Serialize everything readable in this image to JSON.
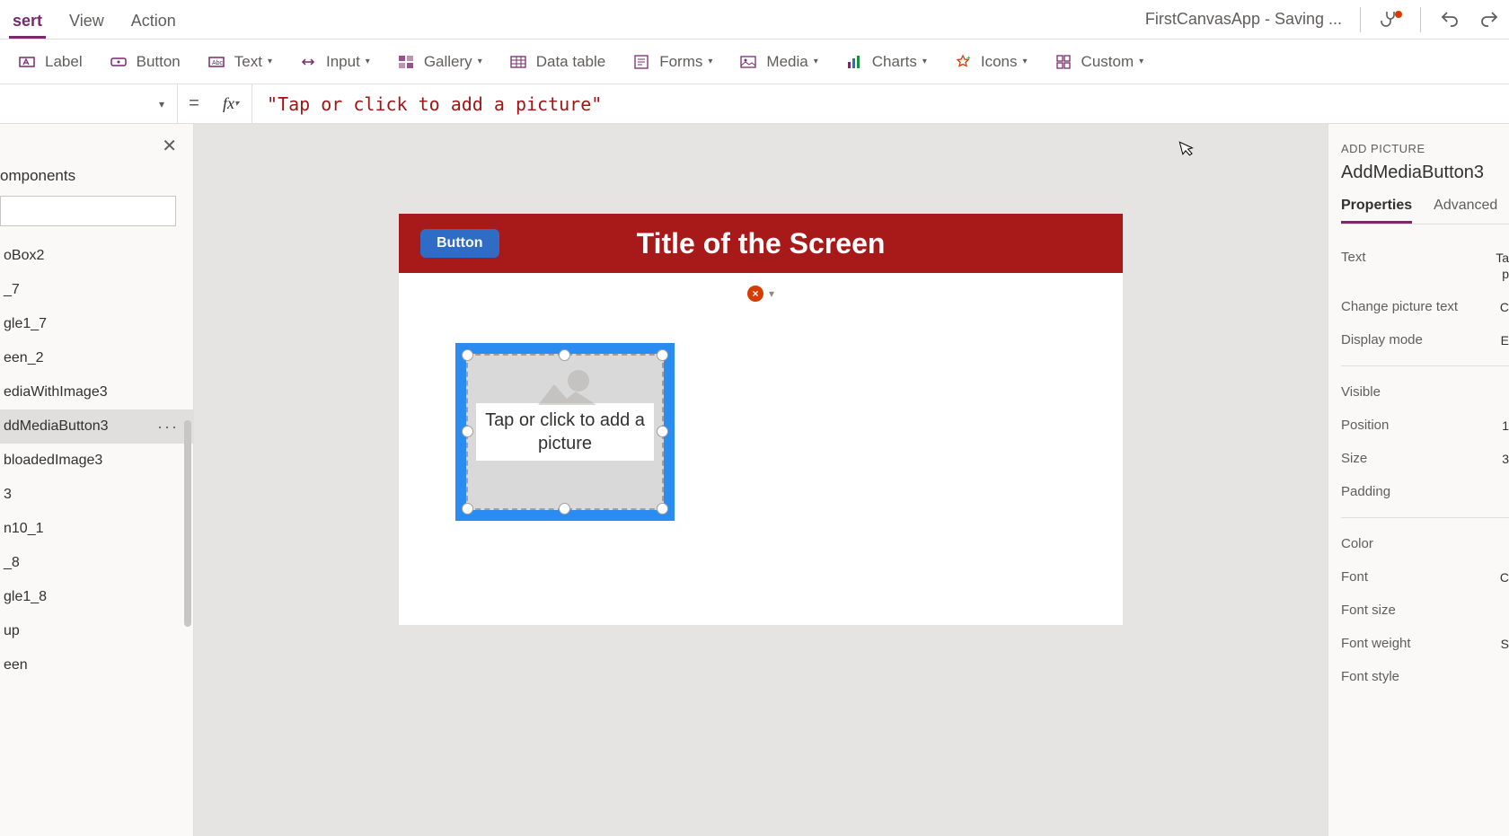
{
  "app_title": "FirstCanvasApp - Saving ...",
  "top_tabs": {
    "insert": "sert",
    "view": "View",
    "action": "Action"
  },
  "ribbon": {
    "label": "Label",
    "button": "Button",
    "text": "Text",
    "input": "Input",
    "gallery": "Gallery",
    "data_table": "Data table",
    "forms": "Forms",
    "media": "Media",
    "charts": "Charts",
    "icons": "Icons",
    "custom": "Custom"
  },
  "formula": {
    "equals": "=",
    "fx": "fx",
    "value": "\"Tap or click to add a picture\""
  },
  "tree": {
    "header": "omponents",
    "items": [
      "oBox2",
      "_7",
      "gle1_7",
      "een_2",
      "ediaWithImage3",
      "ddMediaButton3",
      "bloadedImage3",
      "3",
      "n10_1",
      "_8",
      "gle1_8",
      "up",
      "een"
    ],
    "selected_index": 5,
    "ellipsis": "···"
  },
  "canvas": {
    "title": "Title of the Screen",
    "button": "Button",
    "add_picture_text": "Tap or click to add a picture",
    "error_x": "×"
  },
  "props": {
    "type_label": "ADD PICTURE",
    "name": "AddMediaButton3",
    "tab_properties": "Properties",
    "tab_advanced": "Advanced",
    "rows": {
      "text": "Text",
      "text_val": "Ta",
      "text_val2": "p",
      "change_pic": "Change picture text",
      "change_pic_val": "C",
      "display_mode": "Display mode",
      "display_mode_val": "E",
      "visible": "Visible",
      "position": "Position",
      "position_val": "1",
      "size": "Size",
      "size_val": "3",
      "padding": "Padding",
      "color": "Color",
      "font": "Font",
      "font_val": "C",
      "font_size": "Font size",
      "font_weight": "Font weight",
      "font_weight_val": "S",
      "font_style": "Font style"
    }
  }
}
